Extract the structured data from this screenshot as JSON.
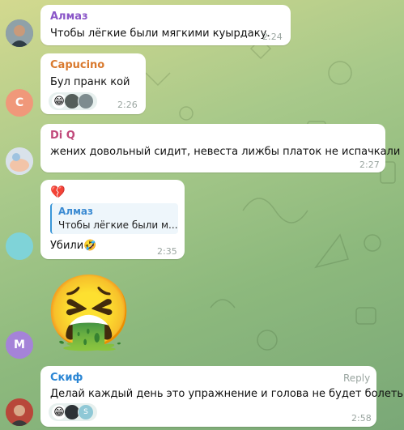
{
  "colors": {
    "background_top": "#d3d98f",
    "background_bottom": "#7aa877",
    "name_almaz": "#8a56c8",
    "name_capucino": "#d9792e",
    "name_diq": "#c0487a",
    "name_skif": "#2b86d4",
    "avatar_c": "#f0987a",
    "avatar_teal": "#7fd3d8",
    "avatar_m": "#a583d8"
  },
  "messages": [
    {
      "sender": "Алмаз",
      "text": "Чтобы лёгкие были мягкими  куырдаку.",
      "time": "2:24",
      "avatar": "photo"
    },
    {
      "sender": "Capucino",
      "text": "Бул пранк кой",
      "time": "2:26",
      "avatar_letter": "C",
      "reactions": {
        "emoji": "😁"
      }
    },
    {
      "sender": "Di Q",
      "text": "жених довольный сидит, невеста лижбы платок не испачкали )))",
      "time": "2:27",
      "avatar": "photo"
    },
    {
      "emoji_top": "💔",
      "reply": {
        "name": "Алмаз",
        "text": "Чтобы лёгкие были м..."
      },
      "text": "Убили🤣",
      "time": "2:35"
    },
    {
      "sticker": "🤮",
      "avatar_letter": "M"
    },
    {
      "sender": "Скиф",
      "reply_label": "Reply",
      "text": "Делай каждый день это упражнение и голова не будет болеть))",
      "time": "2:58",
      "avatar": "photo",
      "reactions": {
        "emoji": "😁",
        "extra_letter": "S"
      }
    }
  ]
}
